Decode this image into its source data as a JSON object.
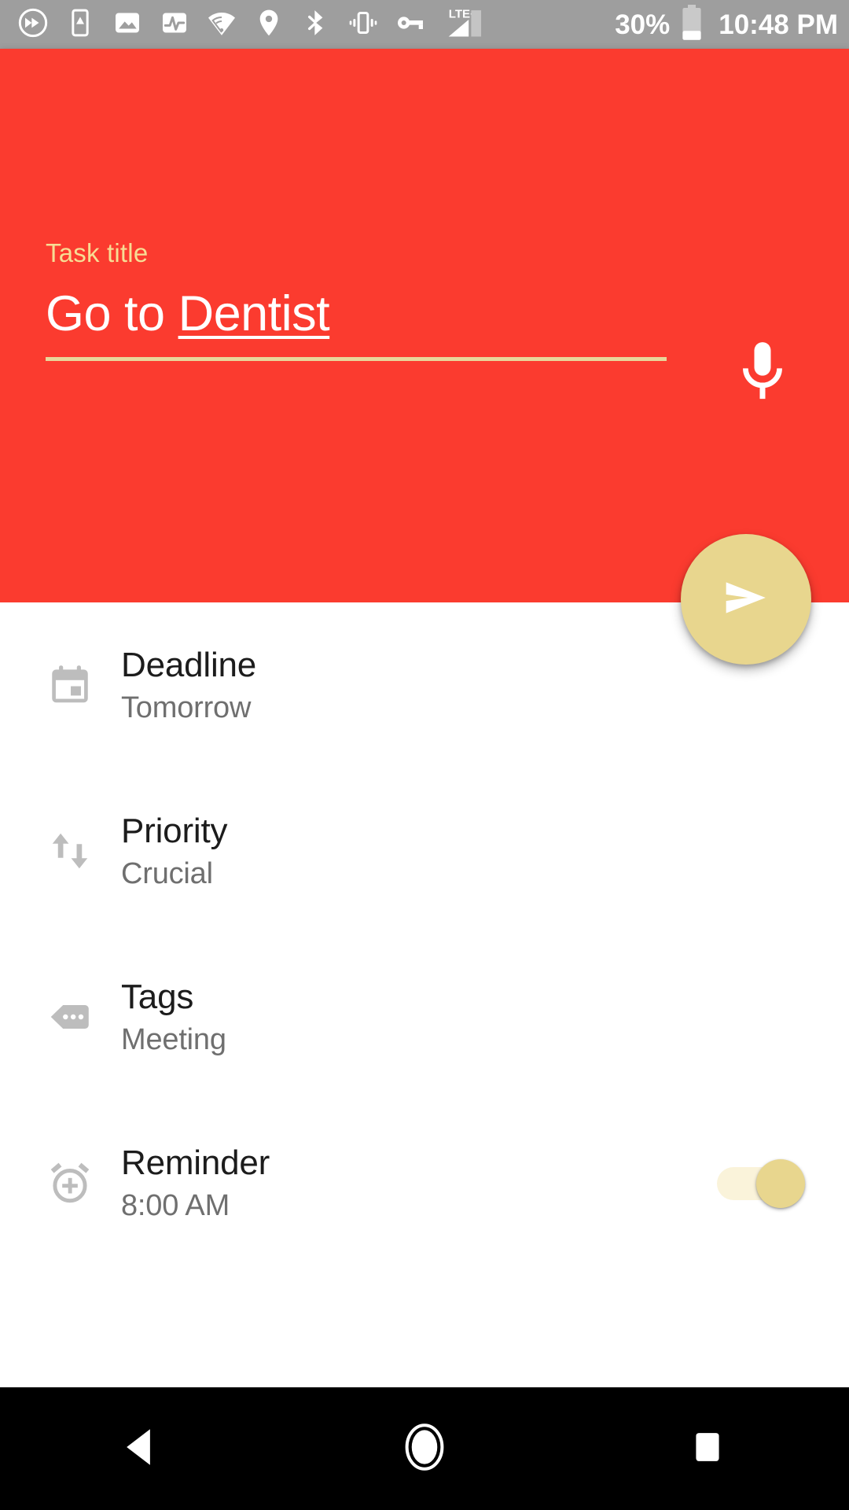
{
  "status_bar": {
    "background": "#9e9e9e",
    "left_icons": [
      {
        "name": "data-saver-icon",
        "label": "data-saver"
      },
      {
        "name": "screen-alert-icon",
        "label": "screen-alert"
      },
      {
        "name": "image-icon",
        "label": "screenshot"
      },
      {
        "name": "pulse-icon",
        "label": "activity"
      },
      {
        "name": "wifi-icon",
        "label": "wifi"
      },
      {
        "name": "location-icon",
        "label": "location"
      },
      {
        "name": "bluetooth-icon",
        "label": "bluetooth"
      },
      {
        "name": "vibrate-icon",
        "label": "vibrate"
      },
      {
        "name": "vpn-key-icon",
        "label": "vpn-key"
      }
    ],
    "network_type": "LTE+",
    "signal_bars": 3,
    "signal_bars_total": 4,
    "battery_percent": "30%",
    "time": "10:48 PM"
  },
  "header": {
    "background": "#fb3b2f",
    "accent": "#e8d68e",
    "label_color": "#f7dd94",
    "field_label": "Task title",
    "field_value_prefix": "Go to ",
    "field_value_composing": "Dentist",
    "field_value_full": "Go to Dentist",
    "field_placeholder": "Task title",
    "mic_icon": "microphone-icon",
    "submit_icon": "send-icon",
    "submit_label": "Send"
  },
  "list": {
    "rows": [
      {
        "icon": "calendar-event-icon",
        "title": "Deadline",
        "value": "Tomorrow",
        "trailing": "none"
      },
      {
        "icon": "swap-vertical-icon",
        "title": "Priority",
        "value": "Crucial",
        "trailing": "none"
      },
      {
        "icon": "tag-icon",
        "title": "Tags",
        "value": "Meeting",
        "trailing": "none"
      },
      {
        "icon": "alarm-add-icon",
        "title": "Reminder",
        "value": "8:00 AM",
        "trailing": "toggle",
        "toggle_on": true,
        "toggle_color": "#e8d68e"
      }
    ]
  },
  "nav_bar": {
    "background": "#000000",
    "back_label": "Back",
    "home_label": "Home",
    "recents_label": "Recents"
  }
}
